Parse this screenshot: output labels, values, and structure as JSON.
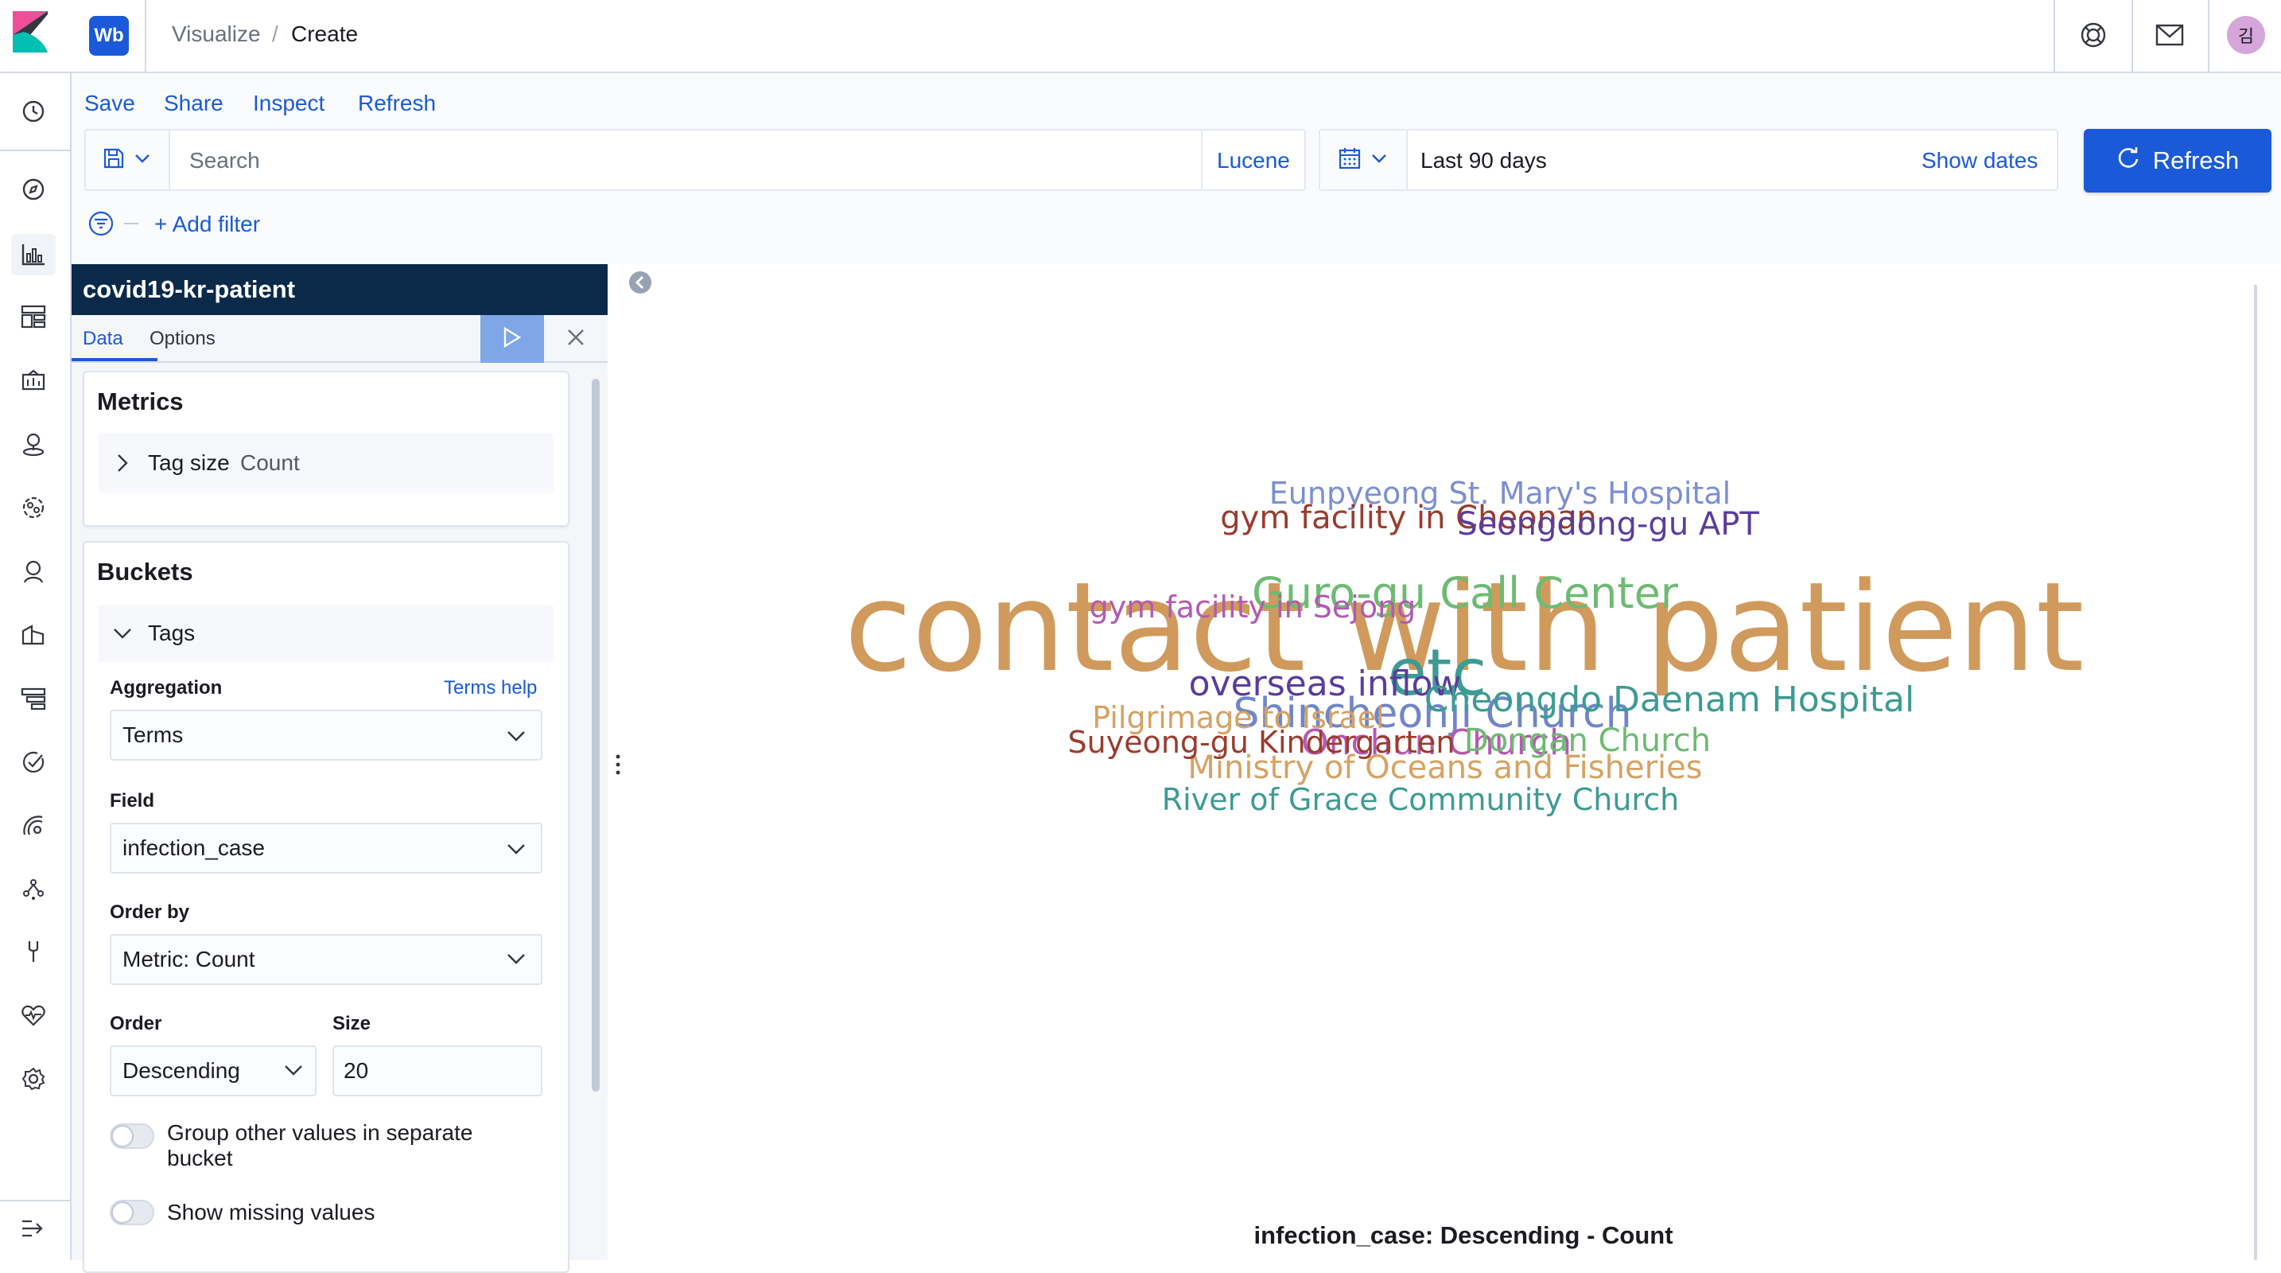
{
  "header": {
    "space_badge": "Wb",
    "breadcrumbs": [
      "Visualize",
      "Create"
    ],
    "breadcrumb_separator": "/",
    "avatar_initial": "김",
    "icons": [
      "kibana-logo-icon",
      "help-icon",
      "newsfeed-mail-icon"
    ]
  },
  "nav": {
    "icons": [
      "recently-viewed-clock-icon",
      "discover-compass-icon",
      "visualize-icon",
      "dashboard-icon",
      "canvas-icon",
      "maps-icon",
      "machine-learning-icon",
      "infrastructure-icon",
      "logs-icon",
      "apm-icon",
      "uptime-icon",
      "siem-icon",
      "graph-icon",
      "dev-tools-icon",
      "monitoring-icon",
      "management-gear-icon",
      "dock-navigation-icon"
    ]
  },
  "menu": {
    "save": "Save",
    "share": "Share",
    "inspect": "Inspect",
    "refresh": "Refresh"
  },
  "query": {
    "placeholder": "Search",
    "language": "Lucene"
  },
  "date": {
    "range": "Last 90 days",
    "show_dates": "Show dates",
    "refresh_button": "Refresh"
  },
  "filter": {
    "add_filter": "+ Add filter"
  },
  "sidebar": {
    "index_pattern": "covid19-kr-patient",
    "tabs": [
      "Data",
      "Options"
    ],
    "active_tab": "Data",
    "metrics": {
      "title": "Metrics",
      "item_label": "Tag size",
      "item_value": "Count"
    },
    "buckets": {
      "title": "Buckets",
      "item_label": "Tags",
      "aggregation_label": "Aggregation",
      "terms_help": "Terms help",
      "aggregation_value": "Terms",
      "field_label": "Field",
      "field_value": "infection_case",
      "order_by_label": "Order by",
      "order_by_value": "Metric: Count",
      "order_label": "Order",
      "order_value": "Descending",
      "size_label": "Size",
      "size_value": "20",
      "group_other_label": "Group other values in separate bucket",
      "group_other_enabled": false,
      "show_missing_label": "Show missing values",
      "show_missing_enabled": false
    }
  },
  "visualization": {
    "caption": "infection_case: Descending - Count",
    "colors": [
      "#6092c0",
      "#d36086",
      "#9170b8",
      "#ca8eae",
      "#d6bf57",
      "#b9a888",
      "#da8b45",
      "#aa6556",
      "#e7664c",
      "#54b399"
    ]
  },
  "chart_data": {
    "type": "wordcloud",
    "title": "",
    "words": [
      {
        "text": "contact with patient",
        "color": "#d09a5d"
      },
      {
        "text": "etc",
        "color": "#3d9b94"
      },
      {
        "text": "Shincheonji Church",
        "color": "#6f86c8"
      },
      {
        "text": "Guro-gu Call Center",
        "color": "#6dbb72"
      },
      {
        "text": "overseas inflow",
        "color": "#5b3c9e"
      },
      {
        "text": "Cheongdo Daenam Hospital",
        "color": "#3d9b94"
      },
      {
        "text": "Eunpyeong St. Mary's Hospital",
        "color": "#7b8fd4"
      },
      {
        "text": "gym facility in Cheonan",
        "color": "#9b3b2d"
      },
      {
        "text": "Seongdong-gu APT",
        "color": "#5b3c9e"
      },
      {
        "text": "Onchun Church",
        "color": "#b35ab2"
      },
      {
        "text": "Ministry of Oceans and Fisheries",
        "color": "#d6a262"
      },
      {
        "text": "Dongan Church",
        "color": "#6dbb72"
      },
      {
        "text": "Pilgrimage to Israel",
        "color": "#d6a262"
      },
      {
        "text": "Suyeong-gu Kindergarten",
        "color": "#9b3b2d"
      },
      {
        "text": "River of Grace Community Church",
        "color": "#3d9b94"
      },
      {
        "text": "gym facility in Sejong",
        "color": "#b35ab2"
      }
    ]
  }
}
